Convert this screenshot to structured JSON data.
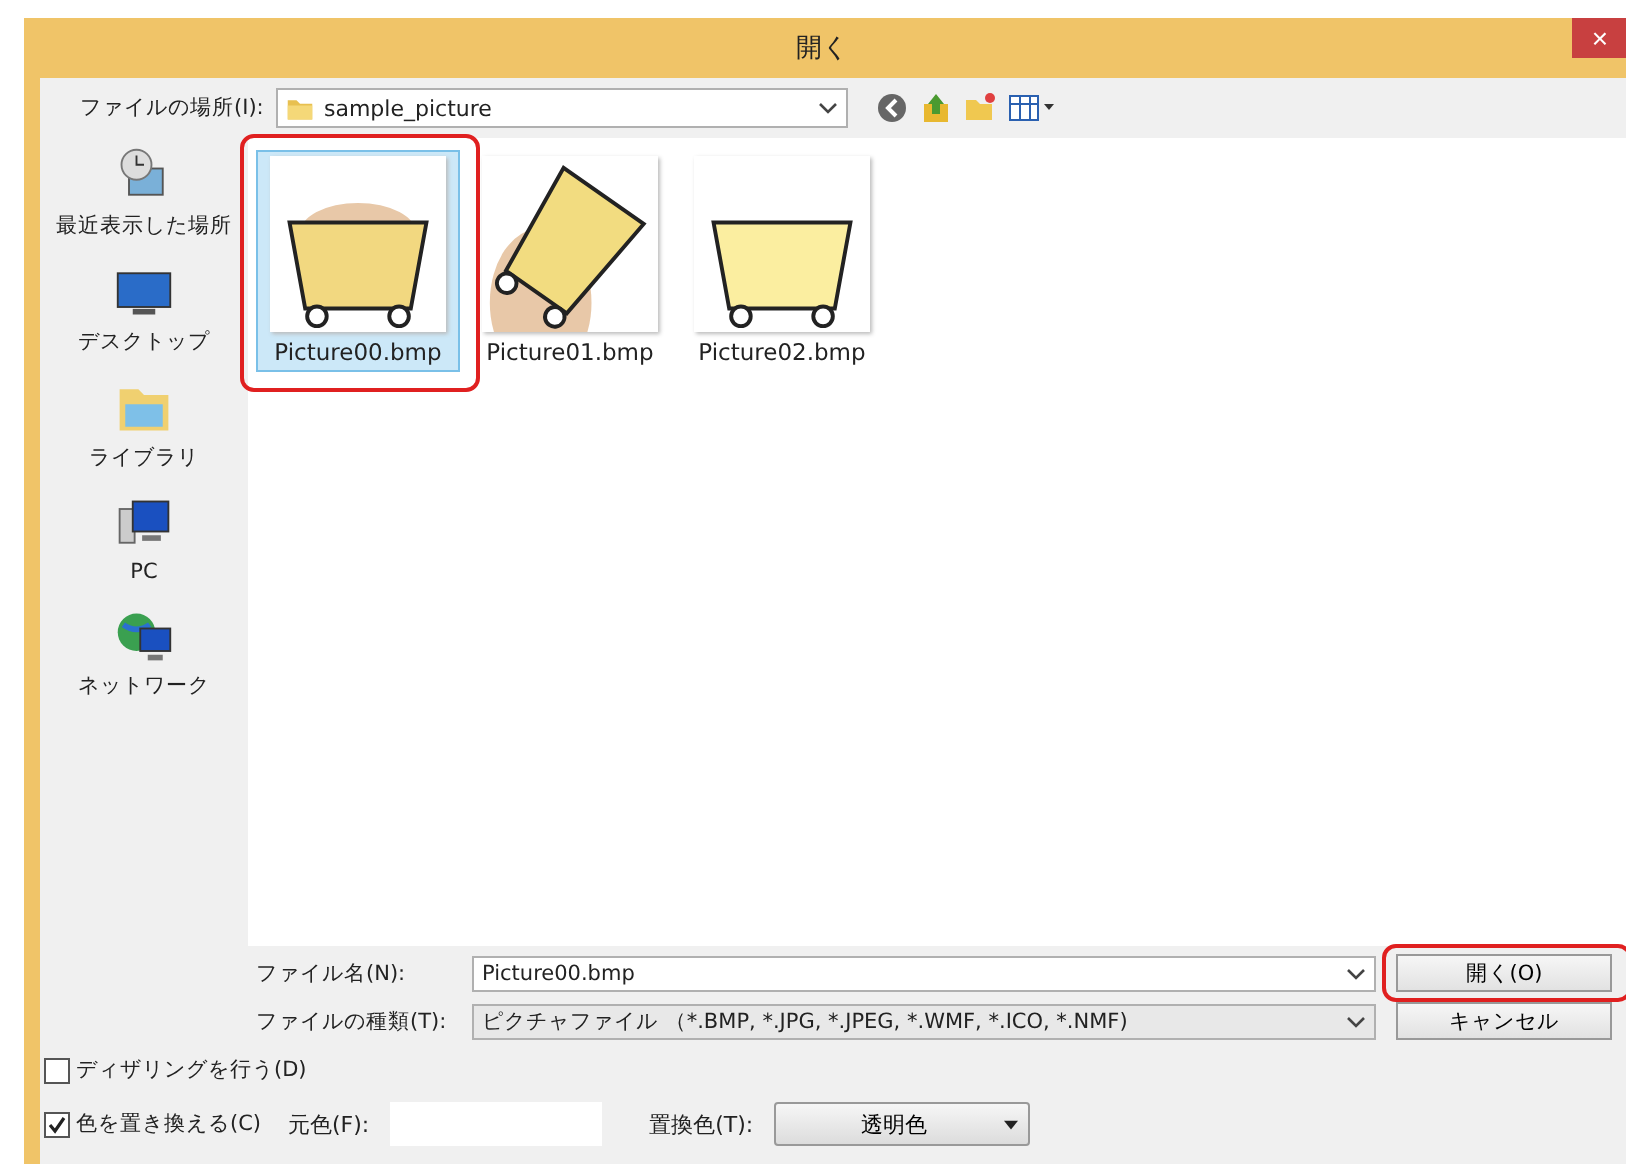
{
  "window": {
    "title": "開く",
    "close": "×"
  },
  "location": {
    "label": "ファイルの場所(I):",
    "value": "sample_picture"
  },
  "sidebar": {
    "items": [
      {
        "label": "最近表示した場所"
      },
      {
        "label": "デスクトップ"
      },
      {
        "label": "ライブラリ"
      },
      {
        "label": "PC"
      },
      {
        "label": "ネットワーク"
      }
    ]
  },
  "files": [
    {
      "name": "Picture00.bmp",
      "selected": true,
      "highlighted": true,
      "tilted": false
    },
    {
      "name": "Picture01.bmp",
      "selected": false,
      "highlighted": false,
      "tilted": true
    },
    {
      "name": "Picture02.bmp",
      "selected": false,
      "highlighted": false,
      "tilted": false
    }
  ],
  "file_name": {
    "label": "ファイル名(N):",
    "value": "Picture00.bmp"
  },
  "file_type": {
    "label": "ファイルの種類(T):",
    "value": "ピクチャファイル （*.BMP, *.JPG, *.JPEG, *.WMF, *.ICO, *.NMF)"
  },
  "buttons": [
    {
      "label": "開く(O)",
      "highlighted": true
    },
    {
      "label": "キャンセル",
      "highlighted": false
    }
  ],
  "options": [
    {
      "kind": "checkbox",
      "label": "ディザリングを行う(D)",
      "checked": false
    },
    {
      "kind": "checkbox",
      "label": "色を置き換える(C)",
      "checked": true,
      "source_label": "元色(F):",
      "replace_label": "置換色(T):",
      "replace_value": "透明色"
    }
  ]
}
